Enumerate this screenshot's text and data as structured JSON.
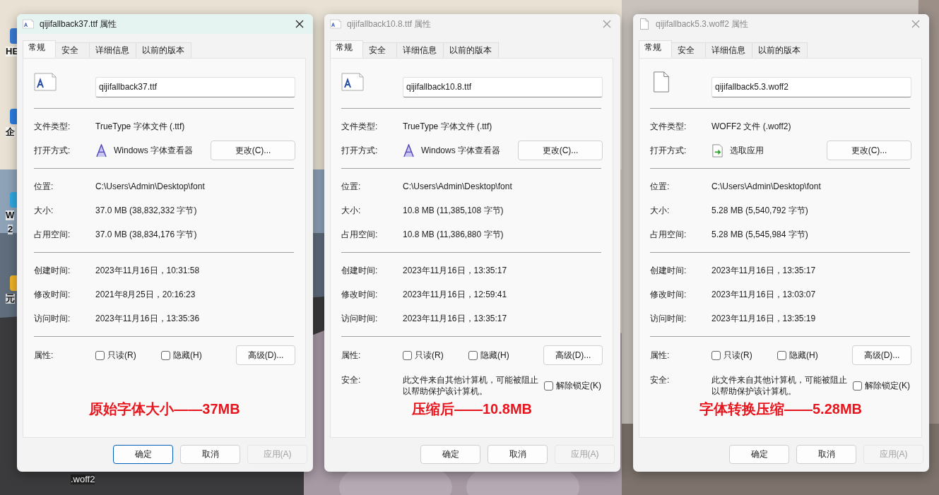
{
  "desktop": {
    "icons": [
      {
        "label": "HE"
      },
      {
        "label": "企"
      },
      {
        "label": "W"
      },
      {
        "label": "2"
      },
      {
        "label": "元"
      },
      {
        "label": ".woff2"
      }
    ]
  },
  "dialogs": [
    {
      "title": "qijifallback37.ttf 属性",
      "active": true,
      "file_icon": {
        "kind": "font"
      },
      "tabs": [
        {
          "label": "常规",
          "selected": true
        },
        {
          "label": "安全",
          "selected": false
        },
        {
          "label": "详细信息",
          "selected": false
        },
        {
          "label": "以前的版本",
          "selected": false
        }
      ],
      "filename": "qijifallback37.ttf",
      "sections": [
        [
          {
            "label": "文件类型:",
            "value": "TrueType 字体文件 (.ttf)"
          },
          {
            "label": "打开方式:",
            "value": "Windows 字体查看器",
            "app_icon": {
              "kind": "font-viewer"
            },
            "button": "更改(C)..."
          }
        ],
        [
          {
            "label": "位置:",
            "value": "C:\\Users\\Admin\\Desktop\\font"
          },
          {
            "label": "大小:",
            "value": "37.0 MB (38,832,332 字节)"
          },
          {
            "label": "占用空间:",
            "value": "37.0 MB (38,834,176 字节)"
          }
        ],
        [
          {
            "label": "创建时间:",
            "value": "2023年11月16日，10:31:58"
          },
          {
            "label": "修改时间:",
            "value": "2021年8月25日，20:16:23"
          },
          {
            "label": "访问时间:",
            "value": "2023年11月16日，13:35:36"
          }
        ]
      ],
      "attributes": {
        "label": "属性:",
        "checkboxes": [
          {
            "label": "只读(R)",
            "checked": false
          },
          {
            "label": "隐藏(H)",
            "checked": false
          }
        ],
        "button": "高级(D)..."
      },
      "annotation": "原始字体大小——37MB",
      "buttons": [
        {
          "label": "确定",
          "kind": "default",
          "disabled": false
        },
        {
          "label": "取消",
          "kind": "normal",
          "disabled": false
        },
        {
          "label": "应用(A)",
          "kind": "normal",
          "disabled": true
        }
      ]
    },
    {
      "title": "qijifallback10.8.ttf 属性",
      "active": false,
      "file_icon": {
        "kind": "font"
      },
      "tabs": [
        {
          "label": "常规",
          "selected": true
        },
        {
          "label": "安全",
          "selected": false
        },
        {
          "label": "详细信息",
          "selected": false
        },
        {
          "label": "以前的版本",
          "selected": false
        }
      ],
      "filename": "qijifallback10.8.ttf",
      "sections": [
        [
          {
            "label": "文件类型:",
            "value": "TrueType 字体文件 (.ttf)"
          },
          {
            "label": "打开方式:",
            "value": "Windows 字体查看器",
            "app_icon": {
              "kind": "font-viewer"
            },
            "button": "更改(C)..."
          }
        ],
        [
          {
            "label": "位置:",
            "value": "C:\\Users\\Admin\\Desktop\\font"
          },
          {
            "label": "大小:",
            "value": "10.8 MB (11,385,108 字节)"
          },
          {
            "label": "占用空间:",
            "value": "10.8 MB (11,386,880 字节)"
          }
        ],
        [
          {
            "label": "创建时间:",
            "value": "2023年11月16日，13:35:17"
          },
          {
            "label": "修改时间:",
            "value": "2023年11月16日，12:59:41"
          },
          {
            "label": "访问时间:",
            "value": "2023年11月16日，13:35:17"
          }
        ]
      ],
      "attributes": {
        "label": "属性:",
        "checkboxes": [
          {
            "label": "只读(R)",
            "checked": false
          },
          {
            "label": "隐藏(H)",
            "checked": false
          }
        ],
        "button": "高级(D)..."
      },
      "security": {
        "label": "安全:",
        "text": "此文件来自其他计算机，可能被阻止以帮助保护该计算机。",
        "checkbox": {
          "label": "解除锁定(K)",
          "checked": false
        }
      },
      "annotation": "压缩后——10.8MB",
      "buttons": [
        {
          "label": "确定",
          "kind": "normal",
          "disabled": false
        },
        {
          "label": "取消",
          "kind": "normal",
          "disabled": false
        },
        {
          "label": "应用(A)",
          "kind": "normal",
          "disabled": true
        }
      ]
    },
    {
      "title": "qijifallback5.3.woff2 属性",
      "active": false,
      "file_icon": {
        "kind": "blank"
      },
      "tabs": [
        {
          "label": "常规",
          "selected": true
        },
        {
          "label": "安全",
          "selected": false
        },
        {
          "label": "详细信息",
          "selected": false
        },
        {
          "label": "以前的版本",
          "selected": false
        }
      ],
      "filename": "qijifallback5.3.woff2",
      "sections": [
        [
          {
            "label": "文件类型:",
            "value": "WOFF2 文件 (.woff2)"
          },
          {
            "label": "打开方式:",
            "value": "选取应用",
            "app_icon": {
              "kind": "choose-app"
            },
            "button": "更改(C)..."
          }
        ],
        [
          {
            "label": "位置:",
            "value": "C:\\Users\\Admin\\Desktop\\font"
          },
          {
            "label": "大小:",
            "value": "5.28 MB (5,540,792 字节)"
          },
          {
            "label": "占用空间:",
            "value": "5.28 MB (5,545,984 字节)"
          }
        ],
        [
          {
            "label": "创建时间:",
            "value": "2023年11月16日，13:35:17"
          },
          {
            "label": "修改时间:",
            "value": "2023年11月16日，13:03:07"
          },
          {
            "label": "访问时间:",
            "value": "2023年11月16日，13:35:19"
          }
        ]
      ],
      "attributes": {
        "label": "属性:",
        "checkboxes": [
          {
            "label": "只读(R)",
            "checked": false
          },
          {
            "label": "隐藏(H)",
            "checked": false
          }
        ],
        "button": "高级(D)..."
      },
      "security": {
        "label": "安全:",
        "text": "此文件来自其他计算机，可能被阻止以帮助保护该计算机。",
        "checkbox": {
          "label": "解除锁定(K)",
          "checked": false
        }
      },
      "annotation": "字体转换压缩——5.28MB",
      "buttons": [
        {
          "label": "确定",
          "kind": "normal",
          "disabled": false
        },
        {
          "label": "取消",
          "kind": "normal",
          "disabled": false
        },
        {
          "label": "应用(A)",
          "kind": "normal",
          "disabled": true
        }
      ]
    }
  ]
}
